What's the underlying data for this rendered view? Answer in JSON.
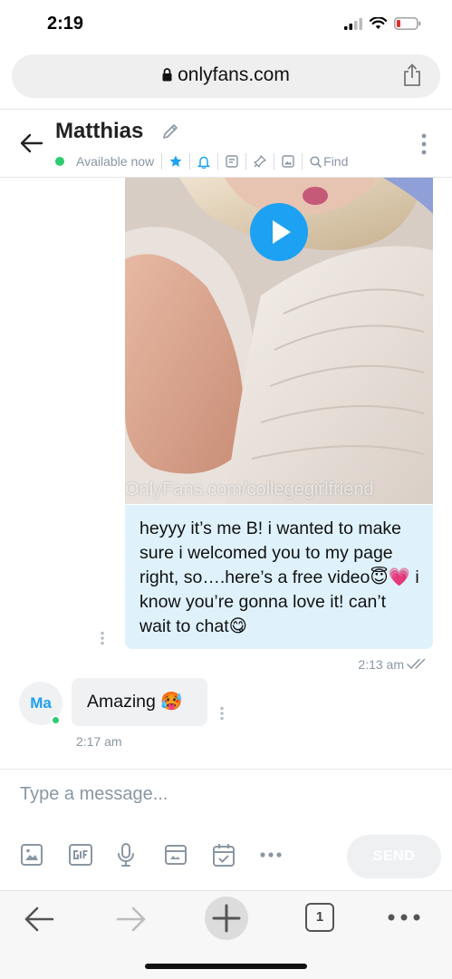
{
  "status_bar": {
    "time": "2:19"
  },
  "browser": {
    "url": "onlyfans.com",
    "tab_count": "1"
  },
  "chat_header": {
    "name": "Matthias",
    "availability": "Available now",
    "find_label": "Find"
  },
  "messages": {
    "outgoing": {
      "watermark": "OnlyFans.com/collegegirlfriend",
      "text": "heyyy it’s me B! i wanted to make sure i welcomed you to my page right, so….here’s a free video😇💗 i know you’re gonna love it! can’t wait to chat😋",
      "time": "2:13 am"
    },
    "incoming": {
      "avatar_initials": "Ma",
      "text": "Amazing 🥵",
      "time": "2:17 am"
    }
  },
  "composer": {
    "placeholder": "Type a message...",
    "send_label": "SEND"
  },
  "colors": {
    "accent": "#1da1f2",
    "online": "#2ecc71",
    "outgoing_bubble": "#dff2fc",
    "incoming_bubble": "#f0f1f3",
    "muted_text": "#8a96a3"
  },
  "icons": [
    "lock-icon",
    "share-icon",
    "back-arrow-icon",
    "edit-icon",
    "star-icon",
    "bell-icon",
    "note-icon",
    "pin-icon",
    "image-icon",
    "search-icon",
    "kebab-icon",
    "play-icon",
    "read-ticks-icon",
    "gif-icon",
    "mic-icon",
    "vault-icon",
    "calendar-icon",
    "more-icon",
    "plus-icon",
    "forward-arrow-icon"
  ]
}
